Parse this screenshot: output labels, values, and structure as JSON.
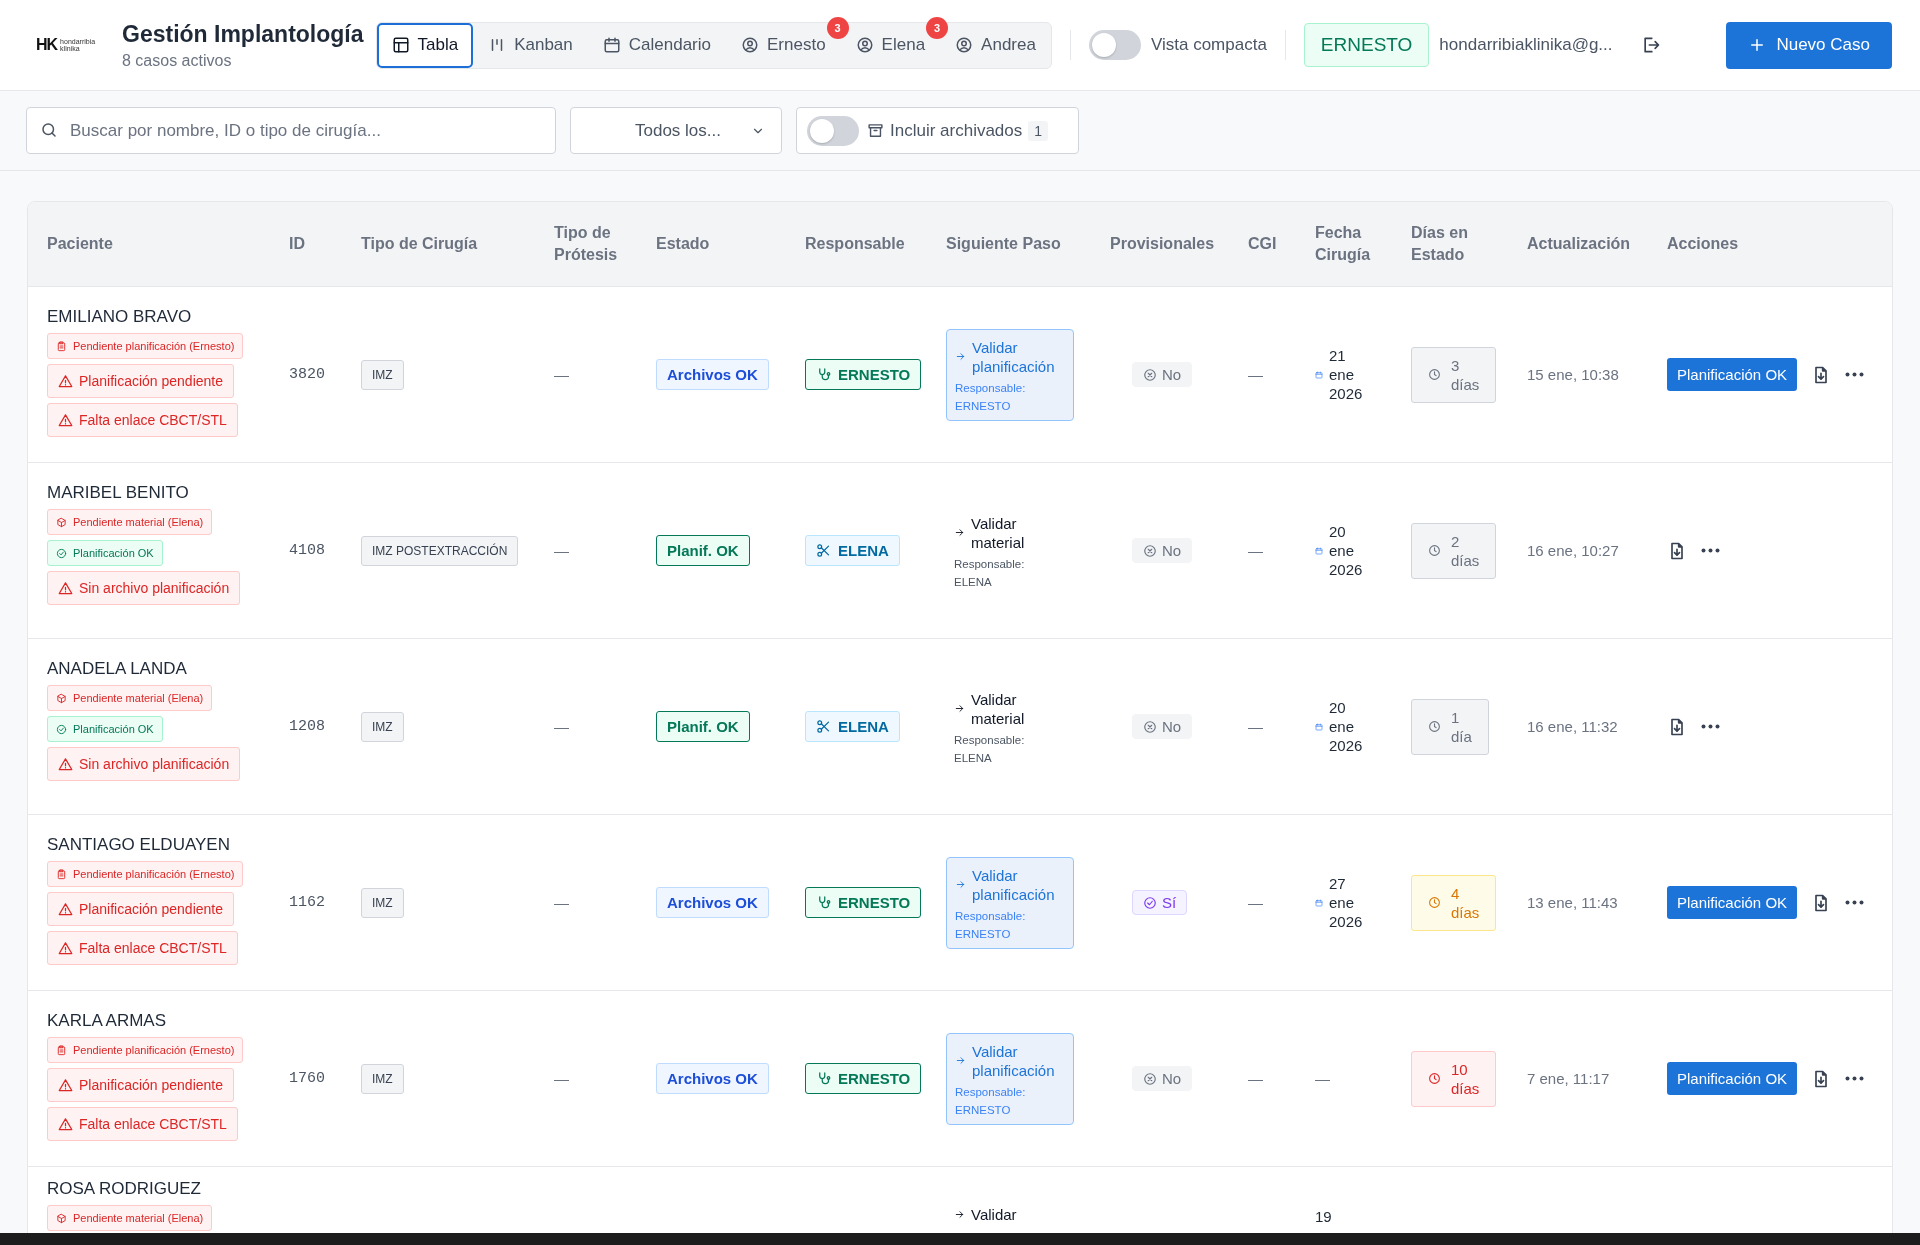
{
  "header": {
    "logo": {
      "mark": "HK",
      "line1": "hondarribia",
      "line2": "klinika"
    },
    "title": "Gestión Implantología",
    "subtitle": "8 casos activos",
    "view_tabs": [
      {
        "label": "Tabla",
        "selected": true
      },
      {
        "label": "Kanban",
        "selected": false
      },
      {
        "label": "Calendario",
        "selected": false
      },
      {
        "label": "Ernesto",
        "selected": false,
        "badge": "3"
      },
      {
        "label": "Elena",
        "selected": false,
        "badge": "3"
      },
      {
        "label": "Andrea",
        "selected": false
      }
    ],
    "compact_view": {
      "label": "Vista compacta",
      "on": false
    },
    "user_badge": "ERNESTO",
    "email": "hondarribiaklinika@g...",
    "new_case_button": "Nuevo Caso"
  },
  "filters": {
    "search": {
      "placeholder": "Buscar por nombre, ID o tipo de cirugía..."
    },
    "status_select": "Todos los...",
    "archived": {
      "label": "Incluir archivados",
      "on": false,
      "count": "1"
    }
  },
  "table": {
    "columns": [
      "Paciente",
      "ID",
      "Tipo de Cirugía",
      "Tipo de Prótesis",
      "Estado",
      "Responsable",
      "Siguiente Paso",
      "Provisionales",
      "CGI",
      "Fecha Cirugía",
      "Días en Estado",
      "Actualización",
      "Acciones"
    ],
    "rows": [
      {
        "patient": "EMILIANO BRAVO",
        "tags": [
          {
            "kind": "clipboard",
            "text": "Pendiente planificación (Ernesto)"
          },
          {
            "kind": "alert",
            "text": "Planificación pendiente"
          },
          {
            "kind": "alert",
            "text": "Falta enlace CBCT/STL"
          }
        ],
        "id": "3820",
        "surgery": "IMZ",
        "prosthesis": "—",
        "status": {
          "kind": "files",
          "text": "Archivos OK"
        },
        "owner": {
          "kind": "doctor",
          "text": "ERNESTO"
        },
        "next_step": {
          "title": "Validar planificación",
          "owner_label": "Responsable:",
          "owner": "ERNESTO",
          "highlighted": true
        },
        "provisionals": {
          "kind": "no",
          "text": "No"
        },
        "cgi": "—",
        "date": {
          "kind": "scheduled",
          "text": "21 ene 2026"
        },
        "days": {
          "kind": "normal",
          "text": "3 días"
        },
        "updated": "15 ene, 10:38",
        "primary_action": "Planificación OK"
      },
      {
        "patient": "MARIBEL BENITO",
        "tags": [
          {
            "kind": "box",
            "text": "Pendiente material (Elena)"
          },
          {
            "kind": "check",
            "text": "Planificación OK"
          },
          {
            "kind": "alert",
            "text": "Sin archivo planificación"
          }
        ],
        "id": "4108",
        "surgery": "IMZ POSTEXTRACCIÓN",
        "prosthesis": "—",
        "status": {
          "kind": "plan",
          "text": "Planif. OK"
        },
        "owner": {
          "kind": "surgery",
          "text": "ELENA"
        },
        "next_step": {
          "title": "Validar material",
          "owner_label": "Responsable:",
          "owner": "ELENA",
          "highlighted": false
        },
        "provisionals": {
          "kind": "no",
          "text": "No"
        },
        "cgi": "—",
        "date": {
          "kind": "scheduled",
          "text": "20 ene 2026"
        },
        "days": {
          "kind": "normal",
          "text": "2 días"
        },
        "updated": "16 ene, 10:27"
      },
      {
        "patient": "ANADELA LANDA",
        "tags": [
          {
            "kind": "box",
            "text": "Pendiente material (Elena)"
          },
          {
            "kind": "check",
            "text": "Planificación OK"
          },
          {
            "kind": "alert",
            "text": "Sin archivo planificación"
          }
        ],
        "id": "1208",
        "surgery": "IMZ",
        "prosthesis": "—",
        "status": {
          "kind": "plan",
          "text": "Planif. OK"
        },
        "owner": {
          "kind": "surgery",
          "text": "ELENA"
        },
        "next_step": {
          "title": "Validar material",
          "owner_label": "Responsable:",
          "owner": "ELENA",
          "highlighted": false
        },
        "provisionals": {
          "kind": "no",
          "text": "No"
        },
        "cgi": "—",
        "date": {
          "kind": "scheduled",
          "text": "20 ene 2026"
        },
        "days": {
          "kind": "normal",
          "text": "1 día"
        },
        "updated": "16 ene, 11:32"
      },
      {
        "patient": "SANTIAGO ELDUAYEN",
        "tags": [
          {
            "kind": "clipboard",
            "text": "Pendiente planificación (Ernesto)"
          },
          {
            "kind": "alert",
            "text": "Planificación pendiente"
          },
          {
            "kind": "alert",
            "text": "Falta enlace CBCT/STL"
          }
        ],
        "id": "1162",
        "surgery": "IMZ",
        "prosthesis": "—",
        "status": {
          "kind": "files",
          "text": "Archivos OK"
        },
        "owner": {
          "kind": "doctor",
          "text": "ERNESTO"
        },
        "next_step": {
          "title": "Validar planificación",
          "owner_label": "Responsable:",
          "owner": "ERNESTO",
          "highlighted": true
        },
        "provisionals": {
          "kind": "yes",
          "text": "Sí"
        },
        "cgi": "—",
        "date": {
          "kind": "scheduled",
          "text": "27 ene 2026"
        },
        "days": {
          "kind": "warning",
          "text": "4 días"
        },
        "updated": "13 ene, 11:43",
        "primary_action": "Planificación OK"
      },
      {
        "patient": "KARLA ARMAS",
        "tags": [
          {
            "kind": "clipboard",
            "text": "Pendiente planificación (Ernesto)"
          },
          {
            "kind": "alert",
            "text": "Planificación pendiente"
          },
          {
            "kind": "alert",
            "text": "Falta enlace CBCT/STL"
          }
        ],
        "id": "1760",
        "surgery": "IMZ",
        "prosthesis": "—",
        "status": {
          "kind": "files",
          "text": "Archivos OK"
        },
        "owner": {
          "kind": "doctor",
          "text": "ERNESTO"
        },
        "next_step": {
          "title": "Validar planificación",
          "owner_label": "Responsable:",
          "owner": "ERNESTO",
          "highlighted": true
        },
        "provisionals": {
          "kind": "no",
          "text": "No"
        },
        "cgi": "—",
        "date": {
          "kind": "none",
          "text": "—"
        },
        "days": {
          "kind": "danger",
          "text": "10 días"
        },
        "updated": "7 ene, 11:17",
        "primary_action": "Planificación OK"
      },
      {
        "patient": "ROSA RODRIGUEZ",
        "tags": [
          {
            "kind": "box",
            "text": "Pendiente material (Elena)"
          }
        ],
        "next_step": {
          "title": "Validar",
          "highlighted": false
        },
        "date": {
          "kind": "plain",
          "text": "19"
        }
      }
    ]
  }
}
